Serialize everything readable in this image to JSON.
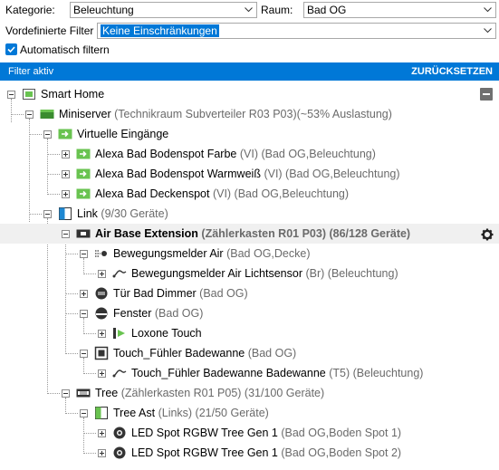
{
  "filters": {
    "category_label": "Kategorie:",
    "category_value": "Beleuchtung",
    "room_label": "Raum:",
    "room_value": "Bad OG",
    "predefined_label": "Vordefinierte Filter",
    "predefined_value": "Keine Einschränkungen",
    "auto_filter_label": "Automatisch filtern",
    "auto_filter_checked": true
  },
  "filter_bar": {
    "status": "Filter aktiv",
    "reset_label": "ZURÜCKSETZEN"
  },
  "tree": {
    "root": "Smart Home",
    "miniserver": {
      "name": "Miniserver",
      "detail": "(Technikraum Subverteiler R03 P03)(~53% Auslastung)"
    },
    "virtual_inputs": {
      "name": "Virtuelle Eingänge"
    },
    "vi1": {
      "name": "Alexa Bad Bodenspot Farbe",
      "detail": "(VI) (Bad OG,Beleuchtung)"
    },
    "vi2": {
      "name": "Alexa Bad Bodenspot Warmweiß",
      "detail": "(VI) (Bad OG,Beleuchtung)"
    },
    "vi3": {
      "name": "Alexa Bad Deckenspot",
      "detail": "(VI) (Bad OG,Beleuchtung)"
    },
    "link": {
      "name": "Link",
      "detail": "(9/30 Geräte)"
    },
    "air_base": {
      "name": "Air Base Extension",
      "detail": "(Zählerkasten R01 P03) (86/128 Geräte)"
    },
    "motion_air": {
      "name": "Bewegungsmelder Air",
      "detail": "(Bad OG,Decke)"
    },
    "motion_light": {
      "name": "Bewegungsmelder Air Lichtsensor",
      "detail": "(Br) (Beleuchtung)"
    },
    "door_dimmer": {
      "name": "Tür Bad Dimmer",
      "detail": "(Bad OG)"
    },
    "window": {
      "name": "Fenster",
      "detail": "(Bad OG)"
    },
    "loxone_touch": {
      "name": "Loxone Touch",
      "detail": ""
    },
    "touch_sensor": {
      "name": "Touch_Fühler Badewanne",
      "detail": "(Bad OG)"
    },
    "touch_sensor_t5": {
      "name": "Touch_Fühler Badewanne Badewanne",
      "detail": "(T5) (Beleuchtung)"
    },
    "tree_ext": {
      "name": "Tree",
      "detail": "(Zählerkasten R01 P05) (31/100 Geräte)"
    },
    "tree_branch": {
      "name": "Tree Ast",
      "detail": "(Links) (21/50 Geräte)"
    },
    "led1": {
      "name": "LED Spot RGBW Tree Gen 1",
      "detail": "(Bad OG,Boden Spot 1)"
    },
    "led2": {
      "name": "LED Spot RGBW Tree Gen 1",
      "detail": "(Bad OG,Boden Spot 2)"
    }
  },
  "colors": {
    "accent": "#0078d7",
    "loxone_green": "#69c350",
    "miniserver_green": "#3a8c2f"
  }
}
